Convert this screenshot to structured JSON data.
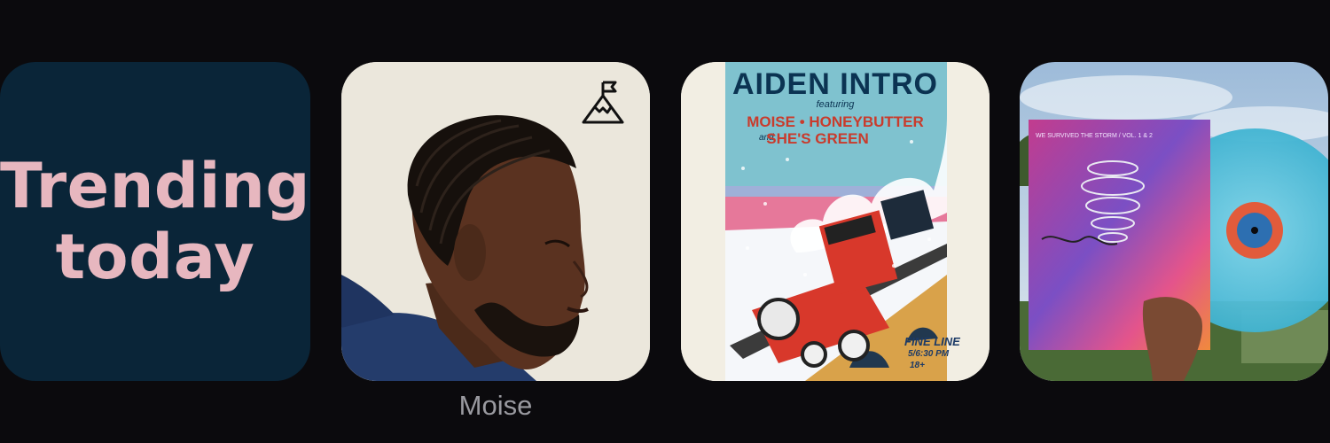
{
  "trending": {
    "line1": "Trending",
    "line2": "today"
  },
  "artist_card": {
    "caption": "Moise",
    "badge_icon": "summit-flag-icon"
  },
  "poster_card": {
    "headline": "AIDEN INTRO",
    "featuring": "featuring",
    "lineup_line1": "MOISE • HONEYBUTTER",
    "lineup_and": "and",
    "lineup_line2": "SHE'S GREEN",
    "venue": "FINE LINE",
    "time": "5/6:30 PM",
    "age": "18+"
  },
  "vinyl_card": {
    "sleeve_text": "WE SURVIVED THE STORM / VOL. 1 & 2"
  },
  "colors": {
    "background": "#0b0a0d",
    "trending_bg": "#0a2538",
    "trending_text": "#e7b7bf",
    "caption": "#9a9aa0"
  }
}
